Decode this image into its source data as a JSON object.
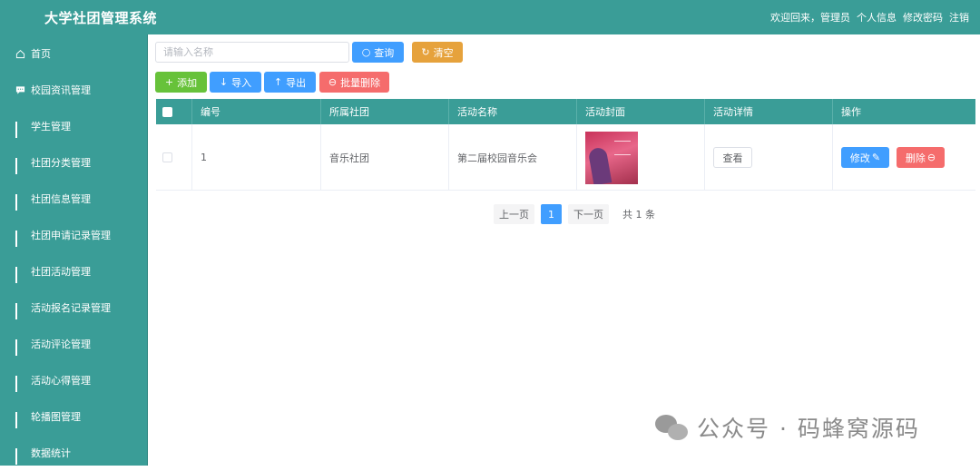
{
  "header": {
    "app_title": "大学社团管理系统",
    "welcome": "欢迎回来，管理员",
    "profile": "个人信息",
    "change_password": "修改密码",
    "logout": "注销"
  },
  "sidebar": {
    "items": [
      {
        "label": "首页",
        "icon": "home-icon"
      },
      {
        "label": "校园资讯管理",
        "icon": "chat-icon"
      },
      {
        "label": "学生管理",
        "icon": "grid-icon"
      },
      {
        "label": "社团分类管理",
        "icon": "grid-icon"
      },
      {
        "label": "社团信息管理",
        "icon": "grid-icon"
      },
      {
        "label": "社团申请记录管理",
        "icon": "grid-icon"
      },
      {
        "label": "社团活动管理",
        "icon": "grid-icon"
      },
      {
        "label": "活动报名记录管理",
        "icon": "grid-icon"
      },
      {
        "label": "活动评论管理",
        "icon": "grid-icon"
      },
      {
        "label": "活动心得管理",
        "icon": "grid-icon"
      },
      {
        "label": "轮播图管理",
        "icon": "grid-icon"
      },
      {
        "label": "数据统计",
        "icon": "grid-icon"
      }
    ]
  },
  "search": {
    "placeholder": "请输入名称",
    "query_label": "查询",
    "clear_label": "清空"
  },
  "toolbar": {
    "add_label": "添加",
    "import_label": "导入",
    "export_label": "导出",
    "batch_delete_label": "批量删除"
  },
  "table": {
    "columns": [
      "编号",
      "所属社团",
      "活动名称",
      "活动封面",
      "活动详情",
      "操作"
    ],
    "rows": [
      {
        "id": "1",
        "club": "音乐社团",
        "activity_name": "第二届校园音乐会",
        "view_label": "查看",
        "edit_label": "修改",
        "delete_label": "删除"
      }
    ]
  },
  "pagination": {
    "prev": "上一页",
    "current": "1",
    "next": "下一页",
    "total": "共 1 条"
  },
  "watermark": {
    "text": "公众号 · 码蜂窝源码"
  },
  "colors": {
    "teal": "#3a9d97",
    "primary": "#409eff",
    "success": "#67c23a",
    "warning": "#e6a23c",
    "danger": "#f56c6c"
  }
}
